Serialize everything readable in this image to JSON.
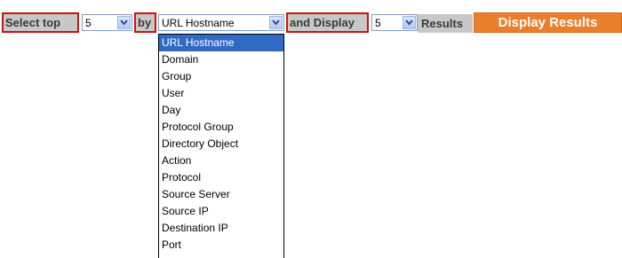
{
  "toolbar": {
    "select_top_label": "Select top",
    "top_count_value": "5",
    "by_label": "by",
    "group_by_value": "URL Hostname",
    "and_display_label": "and Display",
    "display_count_value": "5",
    "results_label": "Results",
    "display_results_button": "Display Results"
  },
  "group_by_options": [
    "URL Hostname",
    "Domain",
    "Group",
    "User",
    "Day",
    "Protocol Group",
    "Directory Object",
    "Action",
    "Protocol",
    "Source Server",
    "Source IP",
    "Destination IP",
    "Port"
  ],
  "selected_option": "URL Hostname",
  "colors": {
    "highlight_border": "#cc1111",
    "button_bg": "#e97e2b",
    "selection_bg": "#316ac5",
    "label_bg": "#c8c8c8"
  }
}
